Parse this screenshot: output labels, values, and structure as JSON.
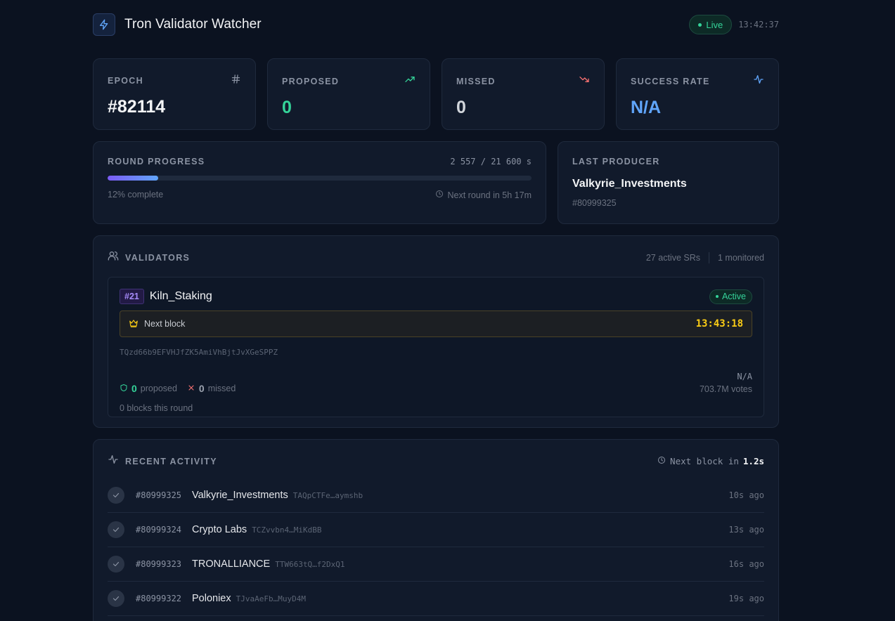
{
  "header": {
    "title": "Tron Validator Watcher",
    "status": "Live",
    "clock": "13:42:37",
    "icon": "lightning-icon"
  },
  "stats": [
    {
      "label": "EPOCH",
      "value": "#82114",
      "icon": "hash-icon",
      "color": "#f3f4f6"
    },
    {
      "label": "PROPOSED",
      "value": "0",
      "icon": "trend-up-icon",
      "color": "#34d399"
    },
    {
      "label": "MISSED",
      "value": "0",
      "icon": "trend-down-icon",
      "color": "#d1d5db"
    },
    {
      "label": "SUCCESS RATE",
      "value": "N/A",
      "icon": "activity-icon",
      "color": "#60a5fa"
    }
  ],
  "round": {
    "label": "ROUND PROGRESS",
    "count": "2 557 / 21 600 s",
    "progress_fraction": 0.12,
    "complete_text": "12% complete",
    "next_round": "Next round in 5h 17m"
  },
  "producer": {
    "label": "LAST PRODUCER",
    "name": "Valkyrie_Investments",
    "block": "#80999325"
  },
  "validators": {
    "title": "VALIDATORS",
    "active_count": "27 active SRs",
    "monitored": "1 monitored",
    "item": {
      "rank": "#21",
      "name": "Kiln_Staking",
      "status": "Active",
      "next_block_label": "Next block",
      "next_block_time": "13:43:18",
      "address": "TQzd66b9EFVHJfZK5AmiVhBjtJvXGeSPPZ",
      "proposed": "0",
      "proposed_label": "proposed",
      "missed": "0",
      "missed_label": "missed",
      "rate": "N/A",
      "votes": "703.7M votes",
      "blocks_round": "0 blocks this round"
    }
  },
  "activity": {
    "title": "RECENT ACTIVITY",
    "next_prefix": "Next block in",
    "next_value": "1.2s",
    "rows": [
      {
        "block": "#80999325",
        "name": "Valkyrie_Investments",
        "addr": "TAQpCTFe…aymshb",
        "ago": "10s ago"
      },
      {
        "block": "#80999324",
        "name": "Crypto Labs",
        "addr": "TCZvvbn4…MiKdBB",
        "ago": "13s ago"
      },
      {
        "block": "#80999323",
        "name": "TRONALLIANCE",
        "addr": "TTW663tQ…f2DxQ1",
        "ago": "16s ago"
      },
      {
        "block": "#80999322",
        "name": "Poloniex",
        "addr": "TJvaAeFb…MuyD4M",
        "ago": "19s ago"
      }
    ]
  }
}
